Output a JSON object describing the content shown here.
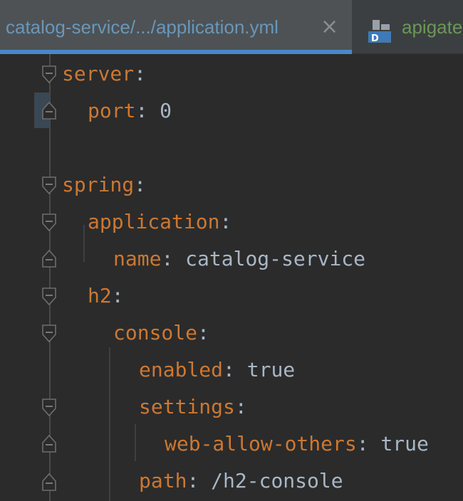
{
  "tabs": [
    {
      "label": "catalog-service/.../application.yml",
      "active": true,
      "close": "×"
    },
    {
      "label": "apigate",
      "icon": "docker-file-icon",
      "icon_letter": "D",
      "active": false
    }
  ],
  "colors": {
    "key": "#cc7832",
    "value": "#a9b7c6",
    "active_tab_text": "#6897bb",
    "active_tab_underline": "#4a88c7",
    "second_tab_text": "#6a9955",
    "background": "#2b2b2b"
  },
  "lines": [
    {
      "key": "server",
      "sep": ":",
      "value": ""
    },
    {
      "key": "port",
      "sep": ": ",
      "value": "0"
    },
    {
      "key": "",
      "sep": "",
      "value": ""
    },
    {
      "key": "spring",
      "sep": ":",
      "value": ""
    },
    {
      "key": "application",
      "sep": ":",
      "value": ""
    },
    {
      "key": "name",
      "sep": ": ",
      "value": "catalog-service"
    },
    {
      "key": "h2",
      "sep": ":",
      "value": ""
    },
    {
      "key": "console",
      "sep": ":",
      "value": ""
    },
    {
      "key": "enabled",
      "sep": ": ",
      "value": "true"
    },
    {
      "key": "settings",
      "sep": ":",
      "value": ""
    },
    {
      "key": "web-allow-others",
      "sep": ": ",
      "value": "true"
    },
    {
      "key": "path",
      "sep": ": ",
      "value": "/h2-console"
    }
  ]
}
